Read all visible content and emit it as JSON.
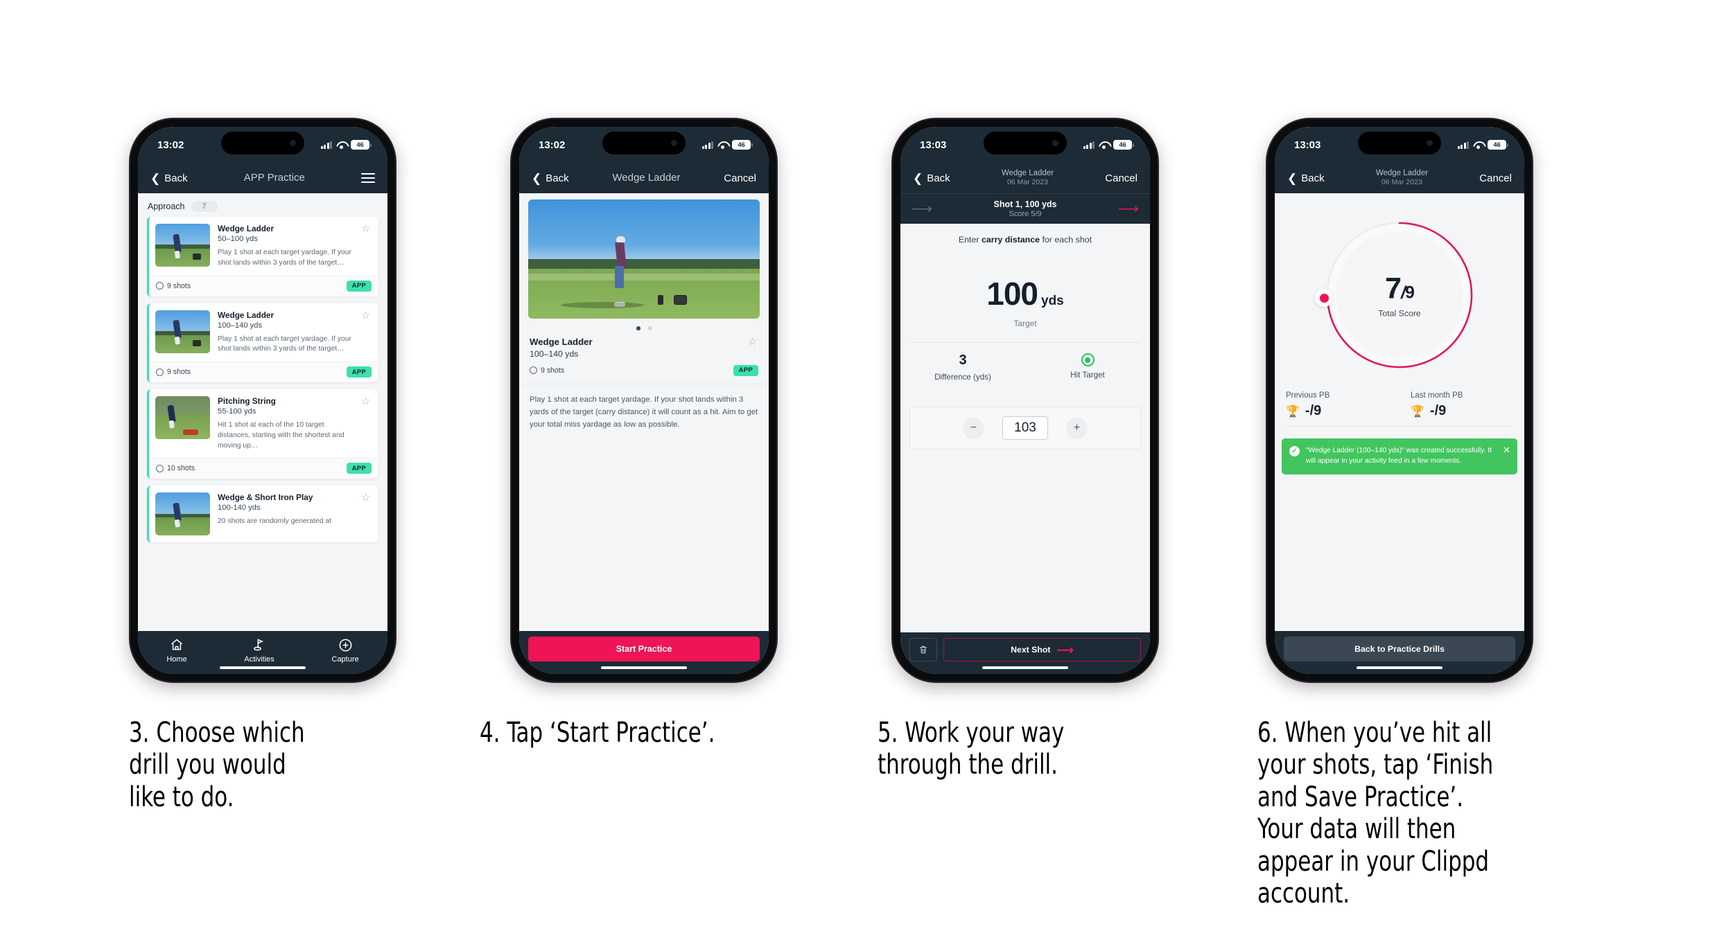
{
  "status_bar": {
    "time_early": "13:02",
    "time_late": "13:03",
    "battery": "46"
  },
  "phone1": {
    "nav": {
      "back": "Back",
      "title": "APP Practice",
      "menu_icon": "hamburger-icon"
    },
    "section": {
      "label": "Approach",
      "count": "7"
    },
    "cards": [
      {
        "title": "Wedge Ladder",
        "yds": "50–100 yds",
        "desc": "Play 1 shot at each target yardage. If your shot lands within 3 yards of the target…",
        "shots": "9 shots",
        "badge": "APP"
      },
      {
        "title": "Wedge Ladder",
        "yds": "100–140 yds",
        "desc": "Play 1 shot at each target yardage. If your shot lands within 3 yards of the target…",
        "shots": "9 shots",
        "badge": "APP"
      },
      {
        "title": "Pitching String",
        "yds": "55-100 yds",
        "desc": "Hit 1 shot at each of the 10 target distances, starting with the shortest and moving up…",
        "shots": "10 shots",
        "badge": "APP"
      },
      {
        "title": "Wedge & Short Iron Play",
        "yds": "100-140 yds",
        "desc": "20 shots are randomly generated at",
        "shots": "",
        "badge": ""
      }
    ],
    "tabs": [
      {
        "label": "Home",
        "icon": "home-icon"
      },
      {
        "label": "Activities",
        "icon": "golf-flag-icon"
      },
      {
        "label": "Capture",
        "icon": "plus-circle-icon"
      }
    ]
  },
  "phone2": {
    "nav": {
      "back": "Back",
      "title": "Wedge Ladder",
      "cancel": "Cancel"
    },
    "detail": {
      "title": "Wedge Ladder",
      "yds": "100–140 yds",
      "shots": "9 shots",
      "badge": "APP",
      "description": "Play 1 shot at each target yardage. If your shot lands within 3 yards of the target (carry distance) it will count as a hit. Aim to get your total miss yardage as low as possible."
    },
    "cta": "Start Practice"
  },
  "phone3": {
    "nav": {
      "back": "Back",
      "title": "Wedge Ladder",
      "date": "06 Mar 2023",
      "cancel": "Cancel"
    },
    "shotbar": {
      "title": "Shot 1, 100 yds",
      "score": "Score 5/9",
      "prev_icon": "arrow-left-icon",
      "next_icon": "arrow-right-icon"
    },
    "prompt_pre": "Enter ",
    "prompt_bold": "carry distance",
    "prompt_post": " for each shot",
    "target": {
      "value": "100",
      "unit": "yds",
      "caption": "Target"
    },
    "stats": [
      {
        "value": "3",
        "label": "Difference (yds)"
      },
      {
        "value": "",
        "label": "Hit Target",
        "icon": "target-hit-icon"
      }
    ],
    "stepper": {
      "minus": "−",
      "value": "103",
      "plus": "+"
    },
    "footer": {
      "delete_icon": "trash-icon",
      "next": "Next Shot",
      "next_icon": "arrow-right-icon"
    }
  },
  "phone4": {
    "nav": {
      "back": "Back",
      "title": "Wedge Ladder",
      "date": "06 Mar 2023",
      "cancel": "Cancel"
    },
    "score": {
      "value": "7",
      "separator": "/",
      "total": "9",
      "caption": "Total Score"
    },
    "pbs": [
      {
        "label": "Previous PB",
        "value": "-/9",
        "icon": "trophy-icon"
      },
      {
        "label": "Last month PB",
        "value": "-/9",
        "icon": "trophy-icon"
      }
    ],
    "toast": {
      "message": "\"Wedge Ladder (100–140 yds)\" was created successfully. It will appear in your activity feed in a few moments.",
      "check_icon": "check-circle-icon",
      "close_icon": "close-icon"
    },
    "footer": {
      "back_to_drills": "Back to Practice Drills"
    }
  },
  "captions": [
    "3. Choose which drill you would like to do.",
    "4. Tap ‘Start Practice’.",
    "5. Work your way through the drill.",
    "6. When you’ve hit all your shots, tap ‘Finish and Save Practice’. Your data will then appear in your Clippd account."
  ],
  "colors": {
    "navy": "#1c2b36",
    "pink": "#ee1455",
    "teal": "#3ddfae",
    "green": "#42c55e",
    "gold": "#f5b517"
  }
}
